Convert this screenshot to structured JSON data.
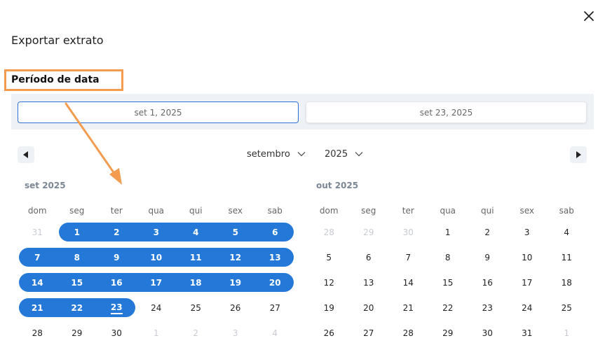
{
  "dialog": {
    "title": "Exportar extrato",
    "section_label": "Período de data",
    "start_date": "set 1, 2025",
    "end_date": "set 23, 2025"
  },
  "nav": {
    "month_select": "setembro",
    "year_select": "2025"
  },
  "weekdays": [
    "dom",
    "seg",
    "ter",
    "qua",
    "qui",
    "sex",
    "sab"
  ],
  "calendars": [
    {
      "label": "set 2025",
      "weeks": [
        [
          {
            "d": "31",
            "m": true
          },
          {
            "d": "1",
            "s": true
          },
          {
            "d": "2",
            "s": true
          },
          {
            "d": "3",
            "s": true
          },
          {
            "d": "4",
            "s": true
          },
          {
            "d": "5",
            "s": true
          },
          {
            "d": "6",
            "s": true
          }
        ],
        [
          {
            "d": "7",
            "s": true
          },
          {
            "d": "8",
            "s": true
          },
          {
            "d": "9",
            "s": true
          },
          {
            "d": "10",
            "s": true
          },
          {
            "d": "11",
            "s": true
          },
          {
            "d": "12",
            "s": true
          },
          {
            "d": "13",
            "s": true
          }
        ],
        [
          {
            "d": "14",
            "s": true
          },
          {
            "d": "15",
            "s": true
          },
          {
            "d": "16",
            "s": true
          },
          {
            "d": "17",
            "s": true
          },
          {
            "d": "18",
            "s": true
          },
          {
            "d": "19",
            "s": true
          },
          {
            "d": "20",
            "s": true
          }
        ],
        [
          {
            "d": "21",
            "s": true
          },
          {
            "d": "22",
            "s": true
          },
          {
            "d": "23",
            "s": true,
            "t": true
          },
          {
            "d": "24"
          },
          {
            "d": "25"
          },
          {
            "d": "26"
          },
          {
            "d": "27"
          }
        ],
        [
          {
            "d": "28"
          },
          {
            "d": "29"
          },
          {
            "d": "30"
          },
          {
            "d": "1",
            "m": true
          },
          {
            "d": "2",
            "m": true
          },
          {
            "d": "3",
            "m": true
          },
          {
            "d": "4",
            "m": true
          }
        ]
      ]
    },
    {
      "label": "out 2025",
      "weeks": [
        [
          {
            "d": "28",
            "m": true
          },
          {
            "d": "29",
            "m": true
          },
          {
            "d": "30",
            "m": true
          },
          {
            "d": "1"
          },
          {
            "d": "2"
          },
          {
            "d": "3"
          },
          {
            "d": "4"
          }
        ],
        [
          {
            "d": "5"
          },
          {
            "d": "6"
          },
          {
            "d": "7"
          },
          {
            "d": "8"
          },
          {
            "d": "9"
          },
          {
            "d": "10"
          },
          {
            "d": "11"
          }
        ],
        [
          {
            "d": "12"
          },
          {
            "d": "13"
          },
          {
            "d": "14"
          },
          {
            "d": "15"
          },
          {
            "d": "16"
          },
          {
            "d": "17"
          },
          {
            "d": "18"
          }
        ],
        [
          {
            "d": "19"
          },
          {
            "d": "20"
          },
          {
            "d": "21"
          },
          {
            "d": "22"
          },
          {
            "d": "23"
          },
          {
            "d": "24"
          },
          {
            "d": "25"
          }
        ],
        [
          {
            "d": "26"
          },
          {
            "d": "27"
          },
          {
            "d": "28"
          },
          {
            "d": "29"
          },
          {
            "d": "30"
          },
          {
            "d": "31"
          },
          {
            "d": "1",
            "m": true
          }
        ]
      ]
    }
  ],
  "colors": {
    "accent": "#2478d8",
    "annotation": "#f39c50",
    "muted": "#c8ccd2"
  },
  "icons": {
    "close": "close-icon",
    "prev": "triangle-left-icon",
    "next": "triangle-right-icon",
    "dropdown": "chevron-down-icon"
  }
}
